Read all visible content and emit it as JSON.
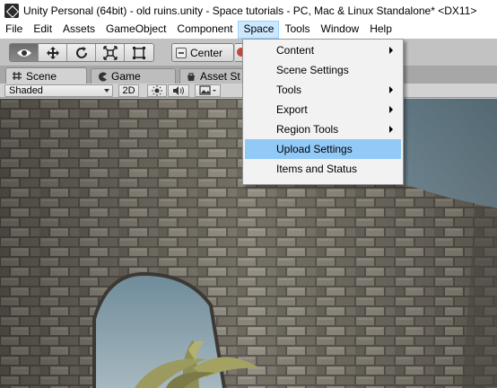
{
  "window": {
    "title": "Unity Personal (64bit) - old ruins.unity - Space tutorials - PC, Mac & Linux Standalone* <DX11>",
    "icon": "unity-logo-icon"
  },
  "menubar": {
    "items": [
      "File",
      "Edit",
      "Assets",
      "GameObject",
      "Component",
      "Space",
      "Tools",
      "Window",
      "Help"
    ],
    "active": "Space"
  },
  "toolbar": {
    "tools": [
      "view-eye-icon",
      "move-arrows-icon",
      "rotate-icon",
      "scale-icon",
      "rect-tool-icon"
    ],
    "selected_tool": "view-eye-icon",
    "pivot_label": "Center"
  },
  "tabs": [
    {
      "label": "Scene",
      "icon": "scene-hash-icon",
      "active": true
    },
    {
      "label": "Game",
      "icon": "game-pacman-icon",
      "active": false
    },
    {
      "label": "Asset St",
      "icon": "asset-store-icon",
      "active": false
    }
  ],
  "scene_toolbar": {
    "shading_mode": "Shaded",
    "mode_2d": "2D",
    "icons": [
      "sun-icon",
      "speaker-icon",
      "image-icon"
    ]
  },
  "space_menu": {
    "items": [
      {
        "label": "Content",
        "submenu": true
      },
      {
        "label": "Scene Settings",
        "submenu": false
      },
      {
        "label": "Tools",
        "submenu": true
      },
      {
        "label": "Export",
        "submenu": true
      },
      {
        "label": "Region Tools",
        "submenu": true
      },
      {
        "label": "Upload Settings",
        "submenu": false,
        "highlighted": true
      },
      {
        "label": "Items and Status",
        "submenu": false
      }
    ]
  },
  "colors": {
    "menu_highlight": "#91c9f7",
    "active_menu": "#cce8ff",
    "sky": "#7c96a3",
    "stone": "#5a5650"
  }
}
